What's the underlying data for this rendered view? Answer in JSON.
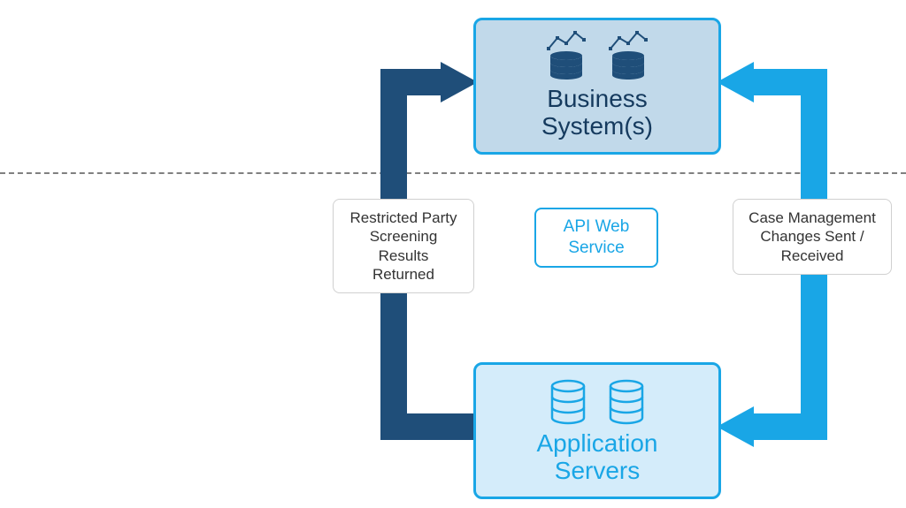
{
  "nodes": {
    "business_systems": {
      "title_line1": "Business",
      "title_line2": "System(s)"
    },
    "application_servers": {
      "title_line1": "Application",
      "title_line2": "Servers"
    }
  },
  "labels": {
    "left": "Restricted Party Screening Results Returned",
    "api": "API Web Service",
    "right": "Case Management Changes Sent / Received"
  },
  "colors": {
    "dark_blue": "#1f4e79",
    "light_blue": "#19a6e6",
    "box_fill_top": "#c1d9ea",
    "box_fill_bottom": "#d4ecfa"
  }
}
